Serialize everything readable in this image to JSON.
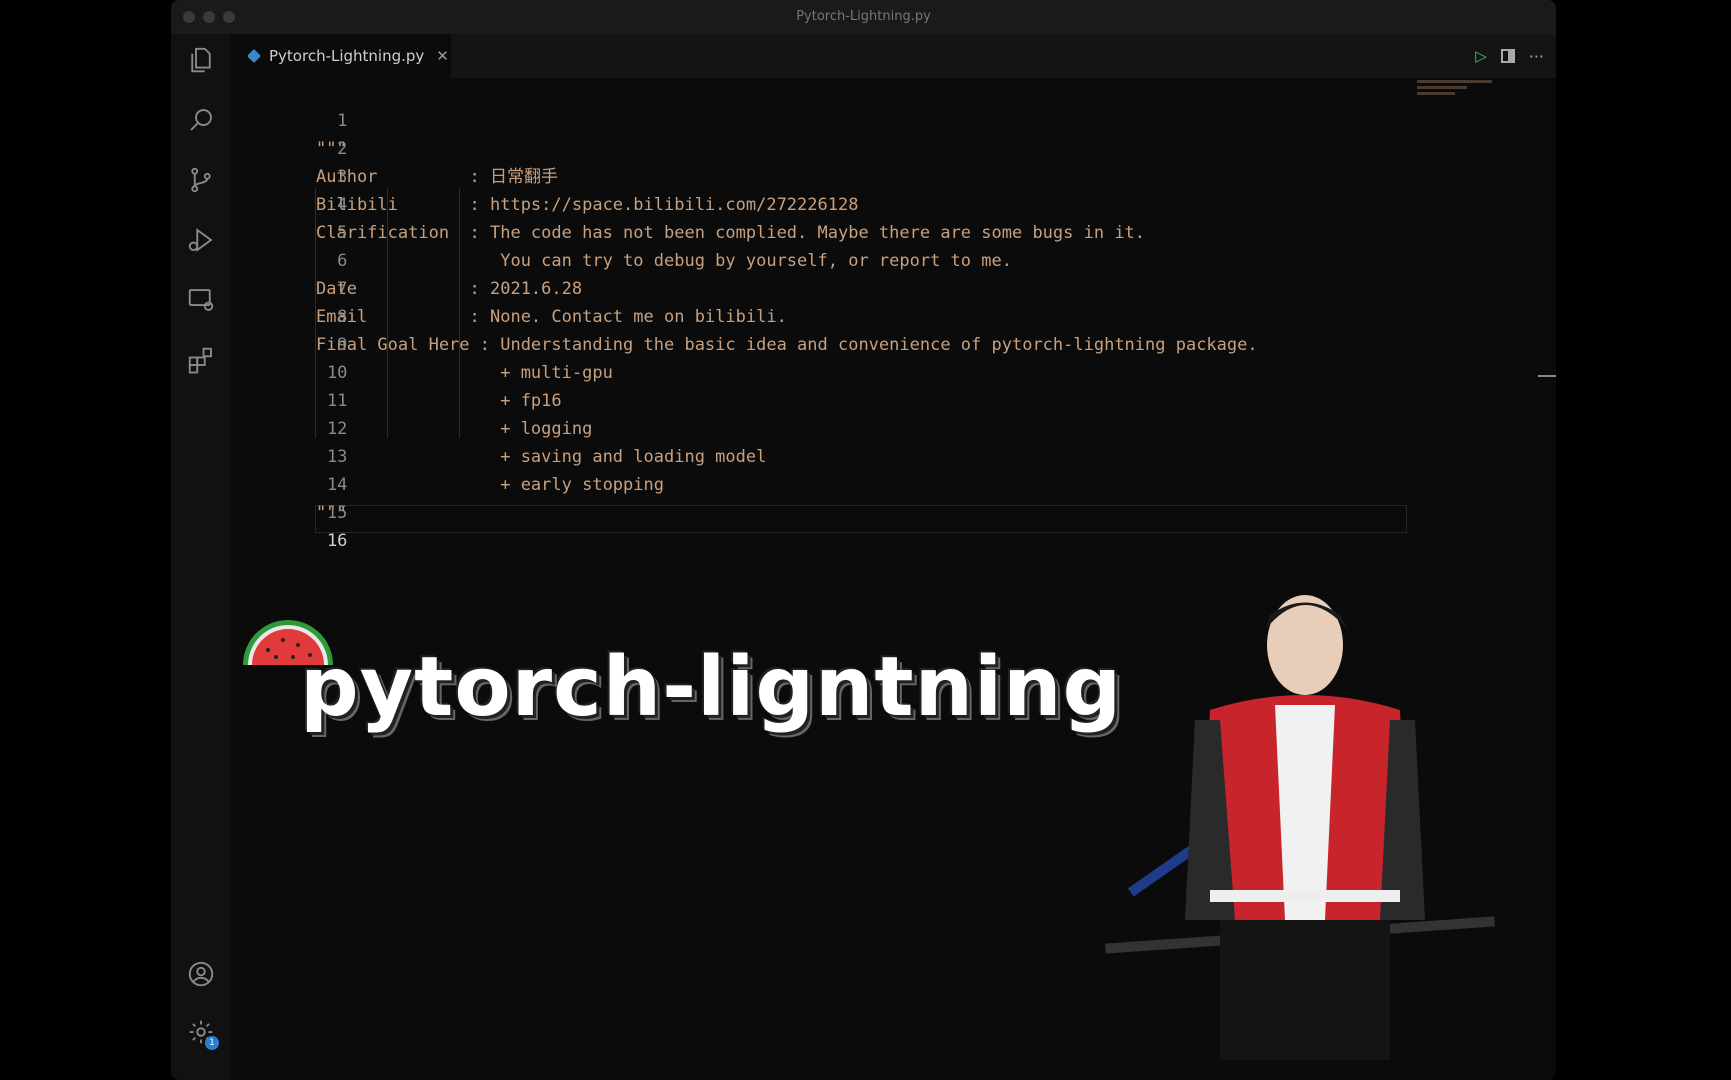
{
  "window": {
    "title": "Pytorch-Lightning.py"
  },
  "tab": {
    "filename": "Pytorch-Lightning.py",
    "close_glyph": "✕"
  },
  "activity_icons": [
    "explorer-icon",
    "search-icon",
    "source-control-icon",
    "run-debug-icon",
    "remote-explorer-icon",
    "extensions-icon",
    "account-icon",
    "settings-gear-icon"
  ],
  "settings_badge": "1",
  "tab_actions": {
    "run": "▷",
    "more": "···"
  },
  "editor": {
    "lines": [
      {
        "n": "1",
        "text": "\"\"\""
      },
      {
        "n": "2",
        "text": "Author         : 日常翻手"
      },
      {
        "n": "3",
        "text": "Bilibili       : https://space.bilibili.com/272226128"
      },
      {
        "n": "4",
        "text": "Clarification  : The code has not been complied. Maybe there are some bugs in it."
      },
      {
        "n": "5",
        "text": "                  You can try to debug by yourself, or report to me."
      },
      {
        "n": "6",
        "text": "Date           : 2021.6.28"
      },
      {
        "n": "7",
        "text": "Email          : None. Contact me on bilibili."
      },
      {
        "n": "8",
        "text": "Final Goal Here : Understanding the basic idea and convenience of pytorch-lightning package."
      },
      {
        "n": "9",
        "text": "                  + multi-gpu"
      },
      {
        "n": "10",
        "text": "                  + fp16"
      },
      {
        "n": "11",
        "text": "                  + logging"
      },
      {
        "n": "12",
        "text": "                  + saving and loading model"
      },
      {
        "n": "13",
        "text": "                  + early stopping"
      },
      {
        "n": "14",
        "text": "\"\"\""
      },
      {
        "n": "15",
        "text": ""
      },
      {
        "n": "16",
        "text": ""
      }
    ]
  },
  "banner": {
    "text": "pytorch-ligntning"
  }
}
